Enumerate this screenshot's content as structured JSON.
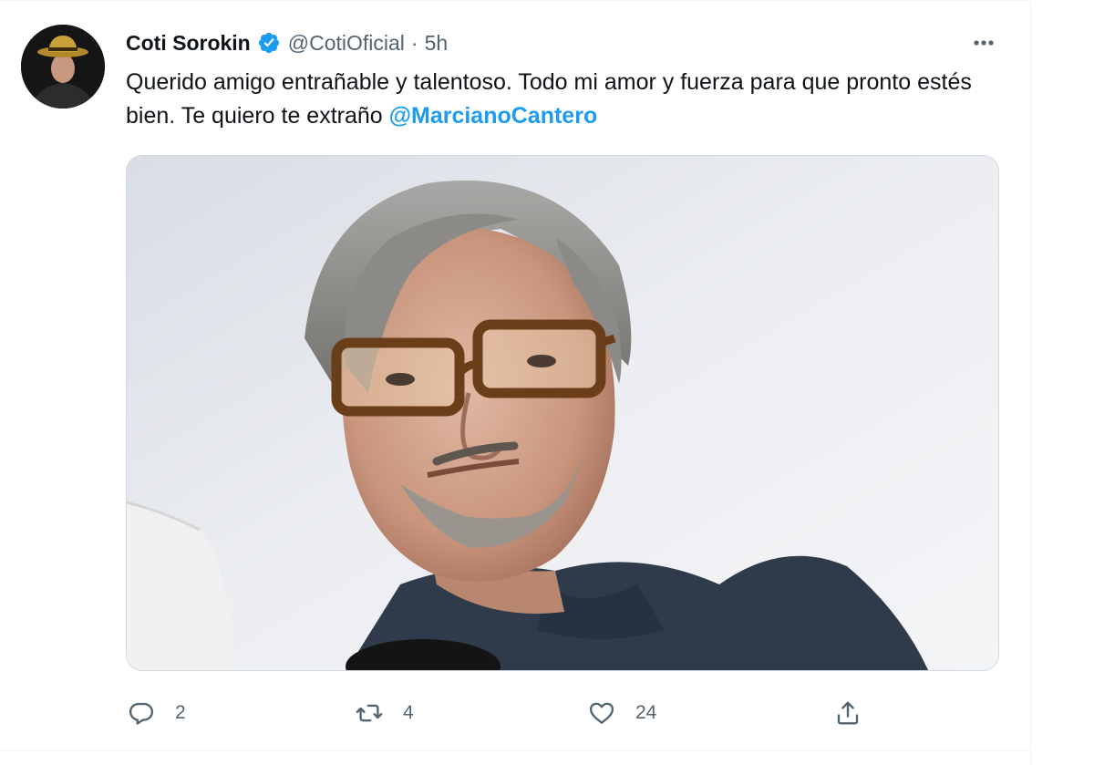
{
  "tweet": {
    "author": {
      "display_name": "Coti Sorokin",
      "handle": "@CotiOficial",
      "verified": true,
      "avatar": "user-avatar"
    },
    "separator": "·",
    "time": "5h",
    "text_main": "Querido amigo entrañable y talentoso. Todo mi amor y fuerza para que pronto estés bien. Te quiero te extraño ",
    "mention": "@MarcianoCantero",
    "media": "tweet-photo",
    "actions": {
      "reply": {
        "icon": "reply-icon",
        "count": "2"
      },
      "retweet": {
        "icon": "retweet-icon",
        "count": "4"
      },
      "like": {
        "icon": "heart-icon",
        "count": "24"
      },
      "share": {
        "icon": "share-icon"
      }
    },
    "more_icon": "more-icon"
  },
  "colors": {
    "text_primary": "#0f1419",
    "text_secondary": "#536471",
    "accent": "#1d9bf0",
    "border": "#cfd9de"
  }
}
